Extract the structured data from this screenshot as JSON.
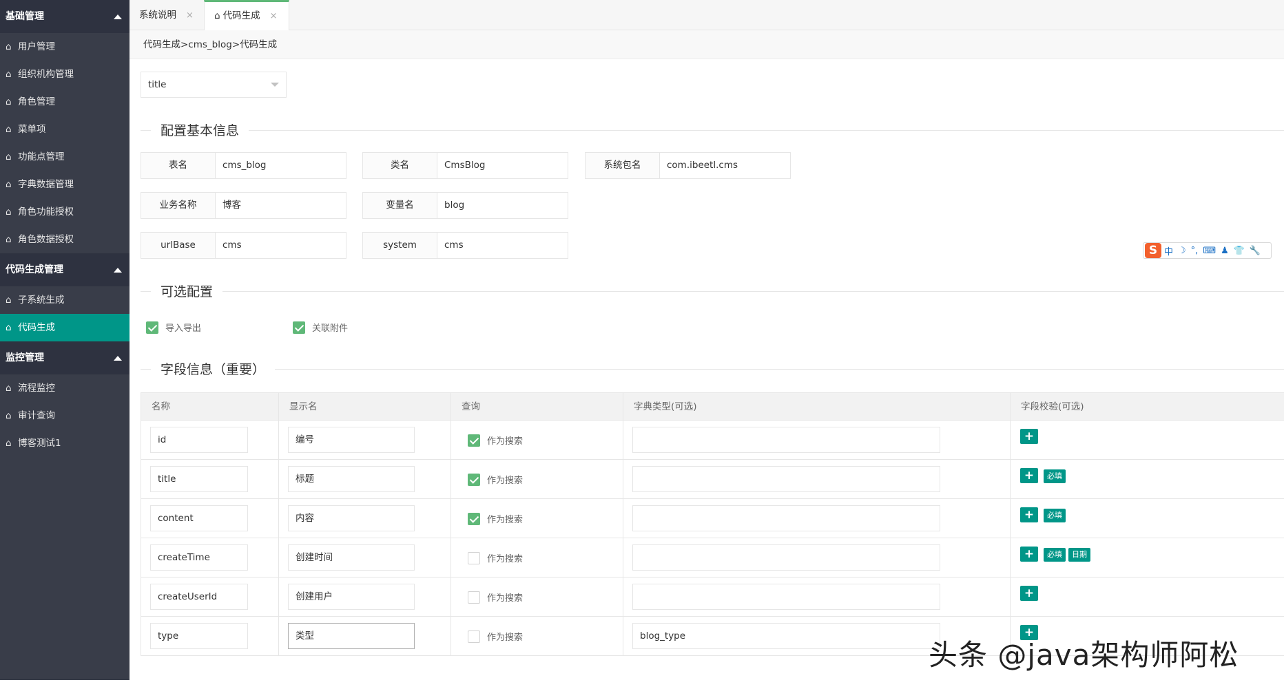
{
  "sidebar": {
    "groups": [
      {
        "label": "基础管理",
        "items": [
          "用户管理",
          "组织机构管理",
          "角色管理",
          "菜单项",
          "功能点管理",
          "字典数据管理",
          "角色功能授权",
          "角色数据授权"
        ]
      },
      {
        "label": "代码生成管理",
        "items": [
          "子系统生成",
          "代码生成"
        ]
      },
      {
        "label": "监控管理",
        "items": [
          "流程监控",
          "审计查询",
          "博客测试1"
        ]
      }
    ],
    "active_item": "代码生成",
    "home_glyph": "⌂"
  },
  "tabs": [
    {
      "label": "系统说明",
      "close": "×"
    },
    {
      "label": "代码生成",
      "close": "×",
      "icon": "⌂"
    }
  ],
  "breadcrumb": "代码生成>cms_blog>代码生成",
  "title_select": {
    "value": "title"
  },
  "sections": {
    "basic": "配置基本信息",
    "optional": "可选配置",
    "fields": "字段信息（重要）"
  },
  "basic_info": {
    "table_name": {
      "label": "表名",
      "value": "cms_blog"
    },
    "class_name": {
      "label": "类名",
      "value": "CmsBlog"
    },
    "package": {
      "label": "系统包名",
      "value": "com.ibeetl.cms"
    },
    "biz_name": {
      "label": "业务名称",
      "value": "博客"
    },
    "var_name": {
      "label": "变量名",
      "value": "blog"
    },
    "url_base": {
      "label": "urlBase",
      "value": "cms"
    },
    "system": {
      "label": "system",
      "value": "cms"
    }
  },
  "options": {
    "import_export": {
      "label": "导入导出",
      "checked": true
    },
    "attachment": {
      "label": "关联附件",
      "checked": true
    }
  },
  "field_table": {
    "headers": [
      "名称",
      "显示名",
      "查询",
      "字典类型(可选)",
      "字段校验(可选)"
    ],
    "search_label": "作为搜索",
    "add_glyph": "+",
    "rows": [
      {
        "name": "id",
        "display": "编号",
        "search": true,
        "dict": "",
        "tags": []
      },
      {
        "name": "title",
        "display": "标题",
        "search": true,
        "dict": "",
        "tags": [
          "必填"
        ]
      },
      {
        "name": "content",
        "display": "内容",
        "search": true,
        "dict": "",
        "tags": [
          "必填"
        ]
      },
      {
        "name": "createTime",
        "display": "创建时间",
        "search": false,
        "dict": "",
        "tags": [
          "必填",
          "日期"
        ]
      },
      {
        "name": "createUserId",
        "display": "创建用户",
        "search": false,
        "dict": "",
        "tags": []
      },
      {
        "name": "type",
        "display": "类型",
        "search": false,
        "dict": "blog_type",
        "tags": []
      }
    ]
  },
  "ime_bar": {
    "logo": "S",
    "items": [
      "中",
      "☽",
      "°,",
      "⌨",
      "♟",
      "👕",
      "🔧"
    ]
  },
  "watermark": "头条 @java架构师阿松",
  "colors": {
    "accent": "#009688",
    "check": "#5fb878",
    "sidebar": "#393d49",
    "sidebar_group": "#2e3240"
  }
}
